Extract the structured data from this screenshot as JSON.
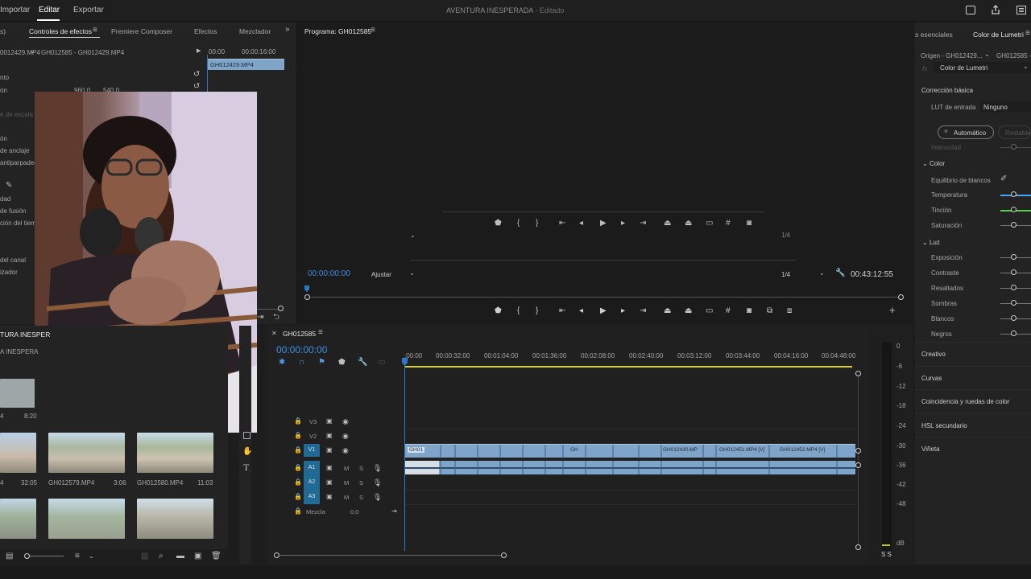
{
  "topbar": {
    "menu": [
      "Importar",
      "Editar",
      "Exportar"
    ],
    "title": "AVENTURA INESPERADA",
    "status": "- Editado"
  },
  "effects_panel": {
    "tabs": [
      "Controles de efectos",
      "Premiere Composer",
      "Efectos",
      "Mezclador"
    ],
    "left_tab_fragment": "s)",
    "clip_source": "0012429.MP4",
    "clip_path": "GH012585 - GH012429.MP4",
    "mini_times": [
      "00:00",
      "00:00:16:00"
    ],
    "mini_clip": "GH012429.MP4",
    "rows": [
      "nto",
      "ón",
      "e de escala",
      "ón",
      "de anclaje",
      "antiparpadeo",
      "",
      "dad",
      "de fusión",
      "ción del tiem",
      "",
      "del canal",
      "izador"
    ],
    "pos_x": "960.0",
    "pos_y": "540.0"
  },
  "project_panel": {
    "title": "TURA INESPER",
    "subtitle": "A INESPERA",
    "thumbs": [
      {
        "name": "4",
        "dur": "8:20"
      },
      {
        "name": "4",
        "dur": "32:05"
      },
      {
        "name": "GH012579.MP4",
        "dur": "3:06"
      },
      {
        "name": "GH012580.MP4",
        "dur": "11:03"
      }
    ]
  },
  "program_monitor": {
    "title": "Programa: GH012585",
    "timecode": "00:00:00:00",
    "fit": "Ajustar",
    "quality": "1/4",
    "quality_top": "1/4",
    "duration": "00:43:12:55"
  },
  "timeline": {
    "sequence": "GH012585",
    "timecode": "00:00:00:00",
    "ruler": [
      ":00:00",
      "00:00:32:00",
      "00:01:04:00",
      "00:01:36:00",
      "00:02:08:00",
      "00:02:40:00",
      "00:03:12:00",
      "00:03:44:00",
      "00:04:16:00",
      "00:04:48:00"
    ],
    "video_tracks": [
      "V3",
      "V2",
      "V1"
    ],
    "audio_tracks": [
      "A1",
      "A2",
      "A3"
    ],
    "source_tag": "V1",
    "mix_label": "Mezcla",
    "mix_value": "0,0",
    "clips": [
      "GH01",
      "GH",
      "GH012430.MP",
      "GH012451.MP4 [V]",
      "GH012452.MP4 [V]"
    ],
    "meter": [
      "0",
      "-6",
      "-12",
      "-18",
      "-24",
      "-30",
      "-36",
      "-42",
      "-48",
      "dB"
    ],
    "meter_solo": "S S"
  },
  "lumetri": {
    "tabs": [
      "s esenciales",
      "Color de Lumetri"
    ],
    "source": "Origen - GH012429...",
    "target": "GH012585 -",
    "fx_label": "fx",
    "effect": "Color de Lumetri",
    "basic": "Corrección básica",
    "lut_label": "LUT de entrada",
    "lut_value": "Ninguno",
    "auto": "Automático",
    "reset": "Restablec",
    "intensity": "Intensidad",
    "color_section": "Color",
    "white_balance": "Equilibrio de blancos",
    "temp": "Temperatura",
    "tint": "Tinción",
    "saturation": "Saturación",
    "light_section": "Luz",
    "light_rows": [
      "Exposición",
      "Contraste",
      "Resaltados",
      "Sombras",
      "Blancos",
      "Negros"
    ],
    "sections": [
      "Creativo",
      "Curvas",
      "Coincidencia y ruedas de color",
      "HSL secundario",
      "Viñeta"
    ],
    "colors": {
      "temp": "#4aa3ff",
      "tint": "#56d24a",
      "accent": "#3f8fe0"
    }
  }
}
